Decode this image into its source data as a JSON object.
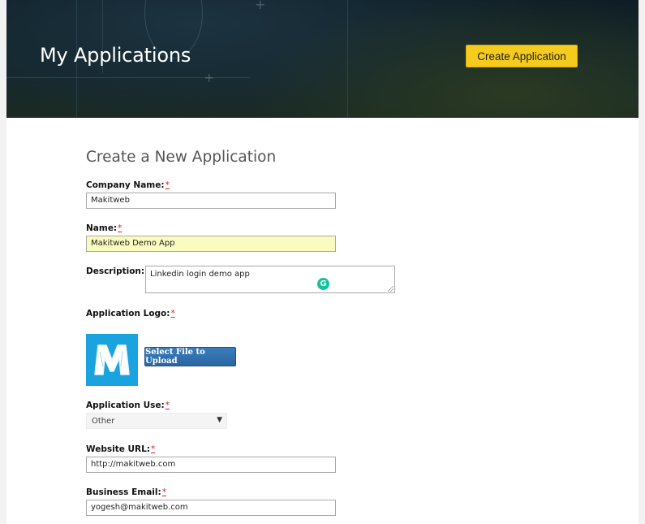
{
  "header": {
    "title": "My Applications",
    "create_button": "Create Application"
  },
  "form": {
    "section_title": "Create a New Application",
    "required_marker": "*",
    "company_name": {
      "label": "Company Name:",
      "value": "Makitweb"
    },
    "name": {
      "label": "Name:",
      "value": "Makitweb Demo App"
    },
    "description": {
      "label": "Description:",
      "value": "Linkedin login demo app"
    },
    "logo": {
      "label": "Application Logo:",
      "upload_button": "Select File to Upload"
    },
    "application_use": {
      "label": "Application Use:",
      "selected": "Other"
    },
    "website_url": {
      "label": "Website URL:",
      "value": "http://makitweb.com"
    },
    "business_email": {
      "label": "Business Email:",
      "value": "yogesh@makitweb.com"
    }
  },
  "colors": {
    "accent_button": "#f5cc1d",
    "upload_button": "#2f6fad",
    "logo_background": "#1aa3de",
    "required": "#cc2222",
    "highlighted_input": "#fafcbf"
  },
  "icons": [
    "grammarly-icon",
    "dropdown-arrow-icon",
    "logo-m-icon",
    "resize-grip-icon"
  ]
}
